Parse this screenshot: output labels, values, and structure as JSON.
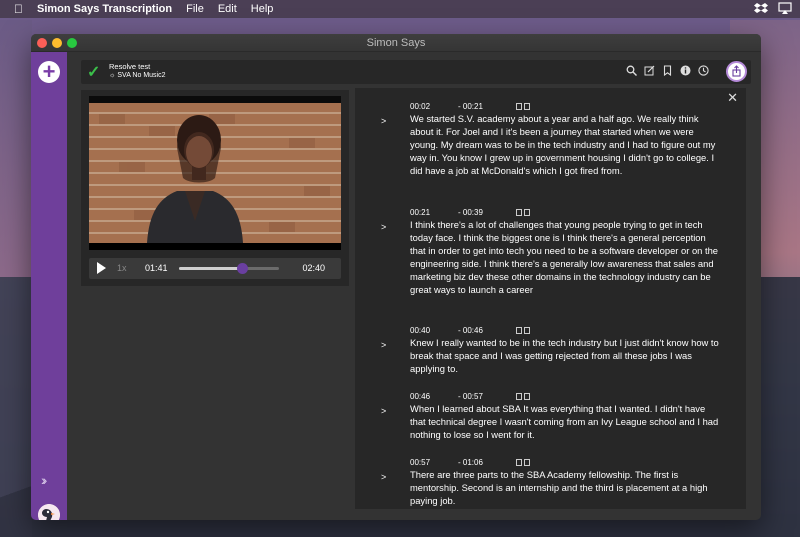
{
  "menubar": {
    "app_name": "Simon Says Transcription",
    "menus": [
      "File",
      "Edit",
      "Help"
    ]
  },
  "window": {
    "title": "Simon Says"
  },
  "toolbar": {
    "project_title": "Resolve test",
    "project_subtitle": "SVA No Music2",
    "icons": [
      "search-icon",
      "edit-icon",
      "bookmark-icon",
      "info-icon",
      "clock-icon",
      "share-icon"
    ]
  },
  "player": {
    "speed": "1x",
    "current_time": "01:41",
    "total_time": "02:40",
    "progress": 0.63
  },
  "transcript": {
    "paragraphs": [
      {
        "start": "00:02",
        "end": "- 00:21",
        "text": "We started S.V. academy about a year and a half ago. We really think about it. For Joel and I it's been a journey that started when we were young. My dream was to be in the tech industry and I had to figure out my way in. You know I grew up in government housing I didn't go to college. I did have a job at McDonald's which I got fired from."
      },
      {
        "start": "00:21",
        "end": "- 00:39",
        "text": "I think there's a lot of challenges that young people trying to get in tech today face. I think the biggest one is I think there's a general perception that in order to get into tech you need to be a software developer or on the engineering side. I think there's a generally low awareness that sales and marketing biz dev these other domains in the technology industry can be great ways to launch a career"
      },
      {
        "start": "00:40",
        "end": "- 00:46",
        "text": "Knew I really wanted to be in the tech industry but I just didn't know how to break that space and I was getting rejected from all these jobs I was applying to."
      },
      {
        "start": "00:46",
        "end": "- 00:57",
        "text": "When I learned about SBA It was everything that I wanted. I didn't have that technical degree I wasn't coming from an Ivy League school and I had nothing to lose so I went for it."
      },
      {
        "start": "00:57",
        "end": "- 01:06",
        "text": "There are three parts to the SBA Academy fellowship. The first is mentorship. Second is an internship and the third is placement at a high paying job."
      }
    ]
  },
  "colors": {
    "sidebar": "#6f3f9b",
    "accent": "#6a3fa0",
    "check": "#3bbf4a"
  }
}
